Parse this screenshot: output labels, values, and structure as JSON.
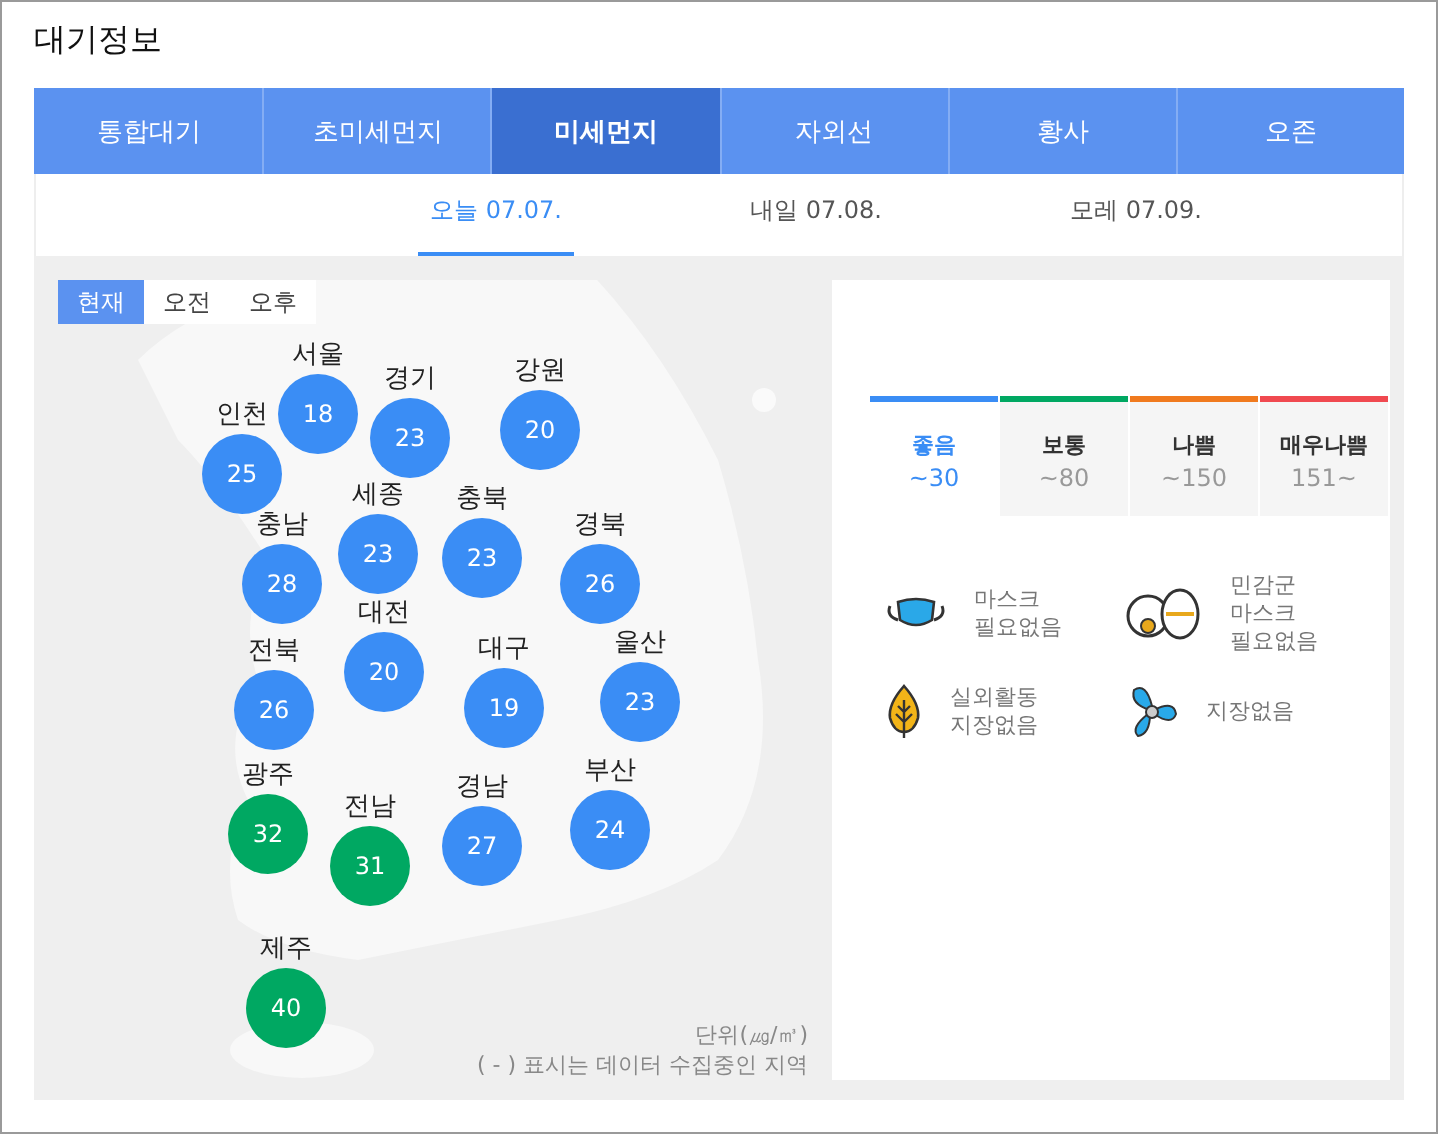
{
  "title": "대기정보",
  "tabs": [
    {
      "label": "통합대기",
      "selected": false
    },
    {
      "label": "초미세먼지",
      "selected": false
    },
    {
      "label": "미세먼지",
      "selected": true
    },
    {
      "label": "자외선",
      "selected": false
    },
    {
      "label": "황사",
      "selected": false
    },
    {
      "label": "오존",
      "selected": false
    }
  ],
  "days": [
    {
      "label": "오늘 07.07.",
      "selected": true
    },
    {
      "label": "내일 07.08.",
      "selected": false
    },
    {
      "label": "모레 07.09.",
      "selected": false
    }
  ],
  "time_tabs": [
    {
      "label": "현재",
      "selected": true
    },
    {
      "label": "오전",
      "selected": false
    },
    {
      "label": "오후",
      "selected": false
    }
  ],
  "regions": [
    {
      "name": "서울",
      "value": "18",
      "color": "#3a8df5"
    },
    {
      "name": "경기",
      "value": "23",
      "color": "#3a8df5"
    },
    {
      "name": "강원",
      "value": "20",
      "color": "#3a8df5"
    },
    {
      "name": "인천",
      "value": "25",
      "color": "#3a8df5"
    },
    {
      "name": "세종",
      "value": "23",
      "color": "#3a8df5"
    },
    {
      "name": "충북",
      "value": "23",
      "color": "#3a8df5"
    },
    {
      "name": "충남",
      "value": "28",
      "color": "#3a8df5"
    },
    {
      "name": "경북",
      "value": "26",
      "color": "#3a8df5"
    },
    {
      "name": "대전",
      "value": "20",
      "color": "#3a8df5"
    },
    {
      "name": "전북",
      "value": "26",
      "color": "#3a8df5"
    },
    {
      "name": "대구",
      "value": "19",
      "color": "#3a8df5"
    },
    {
      "name": "울산",
      "value": "23",
      "color": "#3a8df5"
    },
    {
      "name": "광주",
      "value": "32",
      "color": "#00a862"
    },
    {
      "name": "전남",
      "value": "31",
      "color": "#00a862"
    },
    {
      "name": "경남",
      "value": "27",
      "color": "#3a8df5"
    },
    {
      "name": "부산",
      "value": "24",
      "color": "#3a8df5"
    },
    {
      "name": "제주",
      "value": "40",
      "color": "#00a862"
    }
  ],
  "unit_note": "단위(㎍/㎥)",
  "missing_note": "( - ) 표시는 데이터 수집중인 지역",
  "grades": [
    {
      "label": "좋음",
      "range": "~30",
      "color": "#3a8df5",
      "selected": true
    },
    {
      "label": "보통",
      "range": "~80",
      "color": "#00a862",
      "selected": false
    },
    {
      "label": "나쁨",
      "range": "~150",
      "color": "#f07a1e",
      "selected": false
    },
    {
      "label": "매우나쁨",
      "range": "151~",
      "color": "#f04950",
      "selected": false
    }
  ],
  "advice": [
    {
      "kind": "mask",
      "text": "마스크\n필요없음"
    },
    {
      "kind": "sensitive",
      "text": "민감군\n마스크\n필요없음"
    },
    {
      "kind": "outdoor",
      "text": "실외활동\n지장없음"
    },
    {
      "kind": "ventilation",
      "text": "지장없음"
    }
  ]
}
